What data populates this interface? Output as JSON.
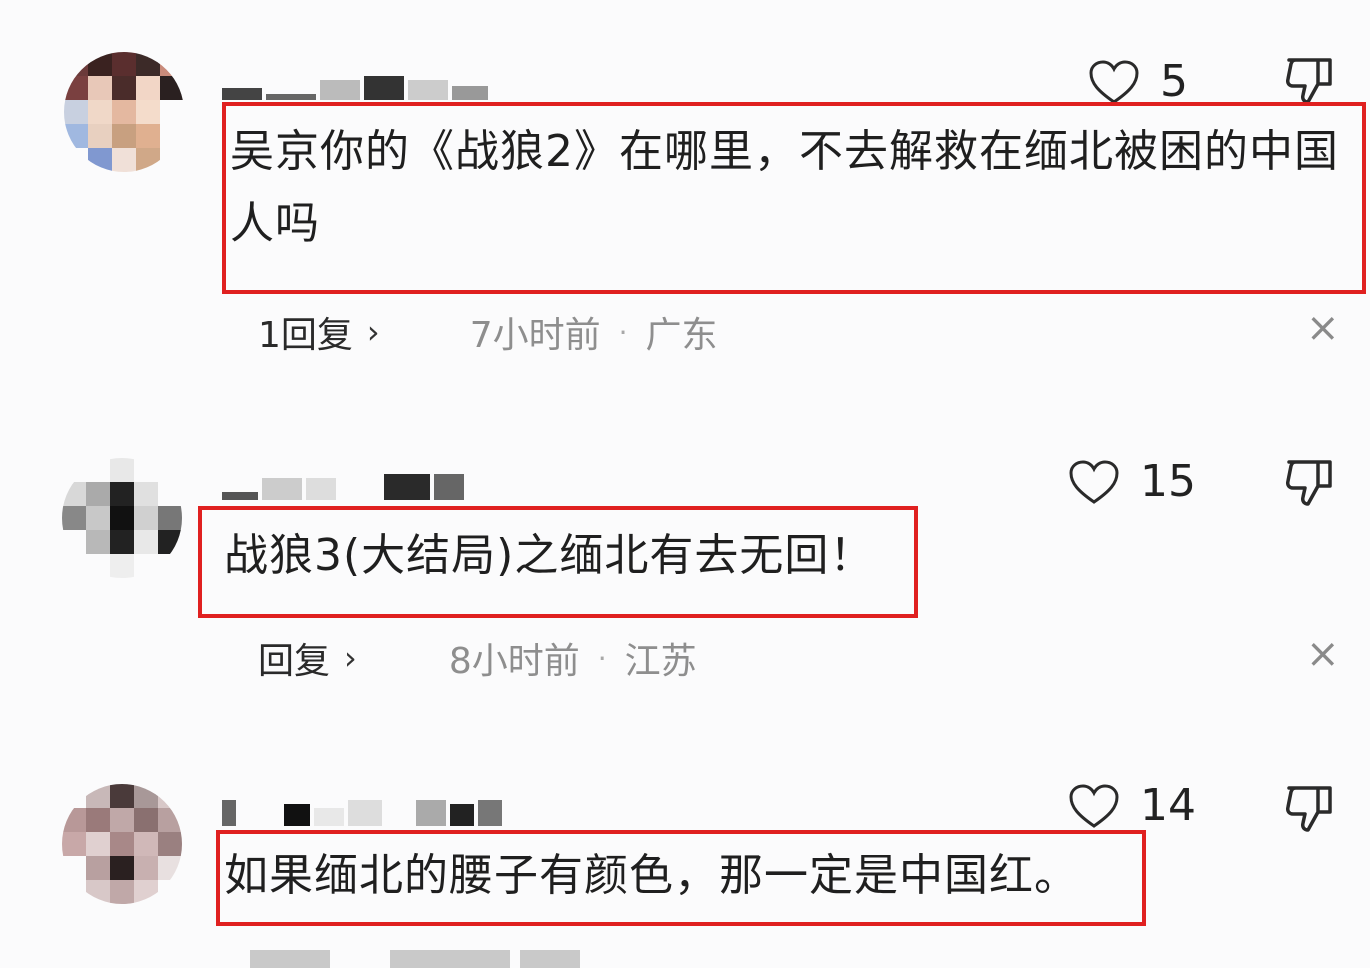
{
  "comments": [
    {
      "text": "吴京你的《战狼2》在哪里，不去解救在缅北被困的中国人吗",
      "likes": "5",
      "reply_label": "1回复",
      "time": "7小时前",
      "location": "广东",
      "highlight_color": "#e02020"
    },
    {
      "text": "战狼3(大结局)之缅北有去无回！",
      "likes": "15",
      "reply_label": "回复",
      "time": "8小时前",
      "location": "江苏",
      "highlight_color": "#e02020"
    },
    {
      "text": "如果缅北的腰子有颜色，那一定是中国红。",
      "likes": "14",
      "highlight_color": "#e02020"
    }
  ],
  "icons": {
    "like": "heart-outline-icon",
    "dislike": "thumbs-down-outline-icon",
    "close": "close-icon",
    "chevron": "chevron-right-icon"
  },
  "glyphs": {
    "chevron": "›",
    "close": "×",
    "separator": "·"
  }
}
